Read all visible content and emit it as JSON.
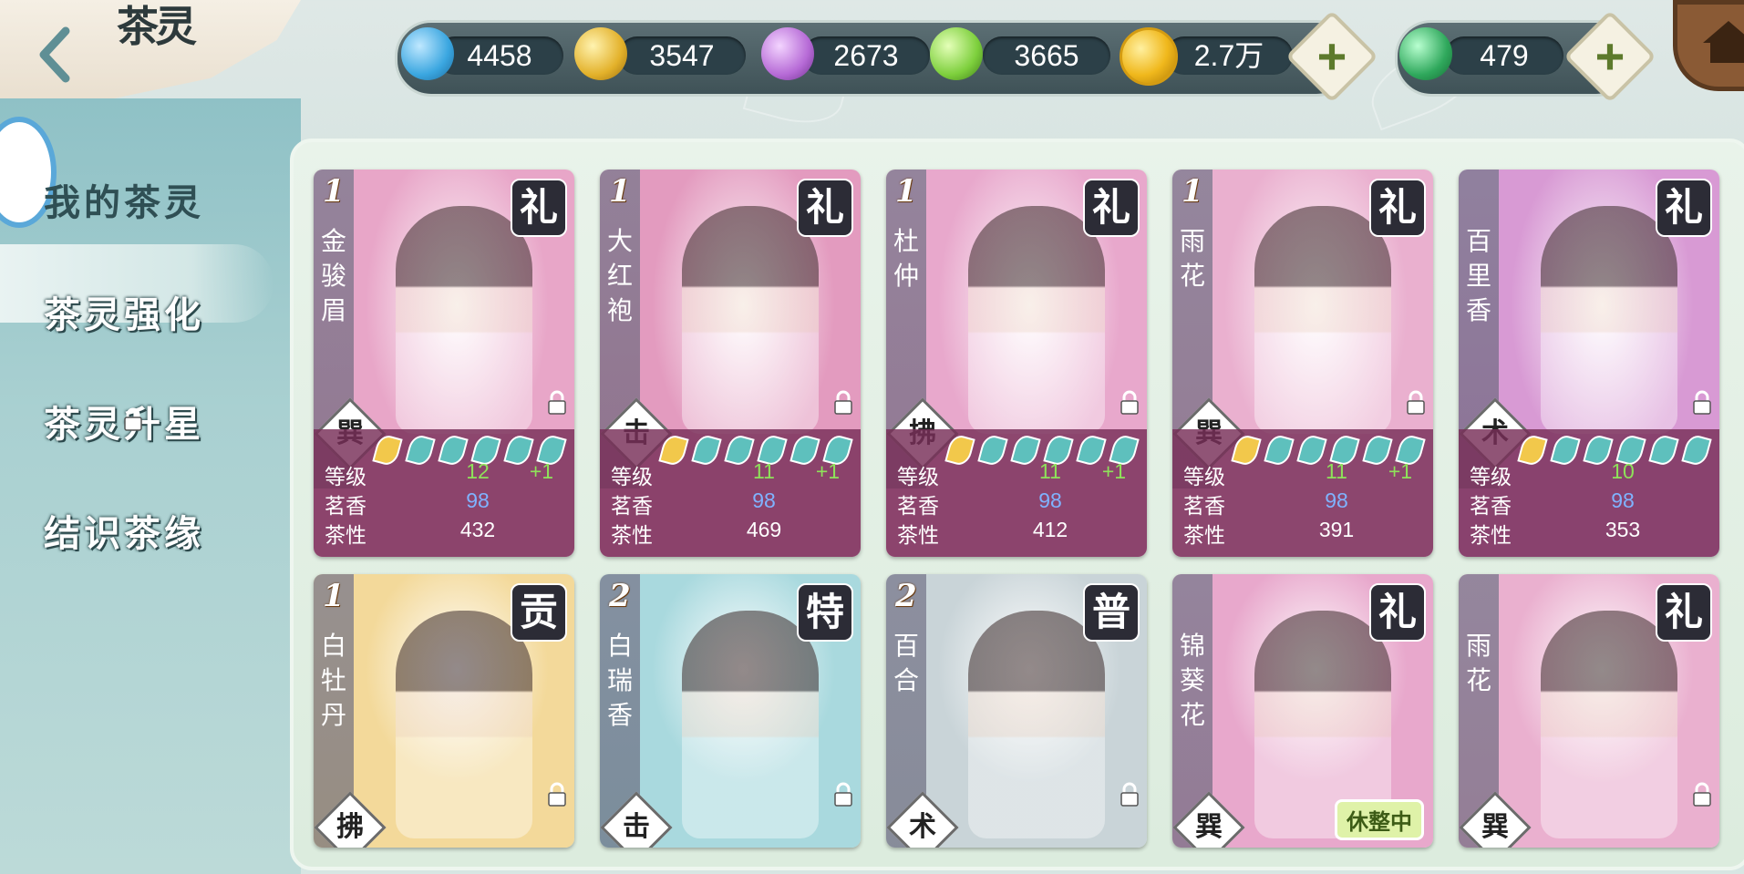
{
  "header": {
    "title": "茶灵"
  },
  "sidebar": {
    "items": [
      {
        "label": "我的茶灵",
        "active": true
      },
      {
        "label": "茶灵强化",
        "active": false
      },
      {
        "label": "茶灵升星",
        "active": false,
        "locked": true
      },
      {
        "label": "结识茶缘",
        "active": false
      }
    ]
  },
  "currencies": [
    {
      "icon": "blue-crystal-icon",
      "value": "4458",
      "color": "#3aa6e0"
    },
    {
      "icon": "gold-crystal-icon",
      "value": "3547",
      "color": "#e3b12a"
    },
    {
      "icon": "purple-crystal-icon",
      "value": "2673",
      "color": "#b66ad6"
    },
    {
      "icon": "green-crystal-icon",
      "value": "3665",
      "color": "#7dcf3c"
    },
    {
      "icon": "gold-coin-icon",
      "value": "2.7万",
      "color": "#f0b81c"
    },
    {
      "icon": "jade-gem-icon",
      "value": "479",
      "color": "#2fa85c"
    }
  ],
  "stat_labels": {
    "level": "等级",
    "aroma": "茗香",
    "nature": "茶性"
  },
  "cards": [
    {
      "rank": "1",
      "name": "金骏眉",
      "badge": "礼",
      "element": "巽",
      "level": "12",
      "bonus": "+1",
      "aroma": "98",
      "nature": "432",
      "palette": "#e8a6c8"
    },
    {
      "rank": "1",
      "name": "大红袍",
      "badge": "礼",
      "element": "击",
      "level": "11",
      "bonus": "+1",
      "aroma": "98",
      "nature": "469",
      "palette": "#e39bbf"
    },
    {
      "rank": "1",
      "name": "杜仲",
      "badge": "礼",
      "element": "拂",
      "level": "11",
      "bonus": "+1",
      "aroma": "98",
      "nature": "412",
      "palette": "#e8a8cc"
    },
    {
      "rank": "1",
      "name": "雨花",
      "badge": "礼",
      "element": "巽",
      "level": "11",
      "bonus": "+1",
      "aroma": "98",
      "nature": "391",
      "palette": "#eab0cf"
    },
    {
      "rank": "",
      "name": "百里香",
      "badge": "礼",
      "element": "术",
      "level": "10",
      "bonus": "",
      "aroma": "98",
      "nature": "353",
      "palette": "#d89ad4"
    },
    {
      "rank": "1",
      "name": "白牡丹",
      "badge": "贡",
      "element": "拂",
      "palette": "#f3d99a"
    },
    {
      "rank": "2",
      "name": "白瑞香",
      "badge": "特",
      "element": "击",
      "palette": "#a9d9de"
    },
    {
      "rank": "2",
      "name": "百合",
      "badge": "普",
      "element": "术",
      "palette": "#c9d4d8"
    },
    {
      "rank": "",
      "name": "锦葵花",
      "badge": "礼",
      "element": "巽",
      "status": "休整中",
      "palette": "#e8a8cc"
    },
    {
      "rank": "",
      "name": "雨花",
      "badge": "礼",
      "element": "巽",
      "palette": "#eab0cf"
    }
  ]
}
